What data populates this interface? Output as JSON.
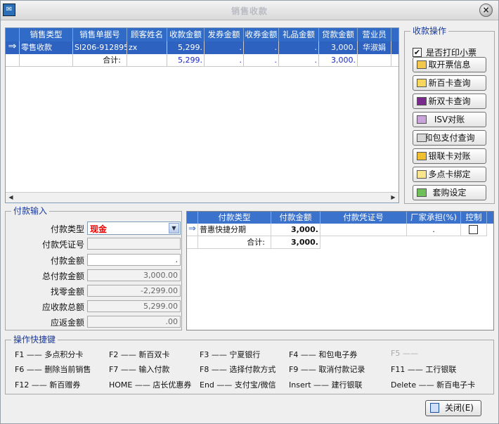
{
  "window": {
    "title": "销售收款"
  },
  "sales_grid": {
    "columns": [
      "销售类型",
      "销售单据号",
      "顾客姓名",
      "收款金额",
      "发券金额",
      "收券金额",
      "礼品金额",
      "贷款金额",
      "营业员"
    ],
    "rows": [
      {
        "type": "零售收款",
        "doc_no": "SI206-912895",
        "customer": "zx",
        "receive": "5,299.",
        "issue_coupon": ".",
        "recv_coupon": ".",
        "gift": ".",
        "loan": "3,000.",
        "clerk": "华淑娟"
      }
    ],
    "total": {
      "label": "合计:",
      "receive": "5,299.",
      "issue_coupon": ".",
      "recv_coupon": ".",
      "gift": ".",
      "loan": "3,000."
    }
  },
  "ops_panel": {
    "title": "收款操作",
    "print_checkbox": {
      "label": "是否打印小票",
      "checked_mark": "✔"
    },
    "buttons": [
      "取开票信息",
      "新百卡查询",
      "新双卡查询",
      "ISV对账",
      "和包支付查询",
      "银联卡对账",
      "多点卡绑定",
      "套购设定"
    ]
  },
  "payment_input": {
    "title": "付款输入",
    "pay_type_label": "付款类型",
    "pay_type_value": "现金",
    "voucher_label": "付款凭证号",
    "voucher_value": "",
    "amount_label": "付款金额",
    "amount_value": ".",
    "total_pay_label": "总付款金额",
    "total_pay_value": "3,000.00",
    "change_label": "找零金额",
    "change_value": "-2,299.00",
    "receivable_label": "应收款总额",
    "receivable_value": "5,299.00",
    "refund_label": "应返金额",
    "refund_value": ".00"
  },
  "payment_grid": {
    "columns": [
      "付款类型",
      "付款金额",
      "付款凭证号",
      "厂家承担(%)",
      "控制"
    ],
    "rows": [
      {
        "type": "普惠快捷分期",
        "amount": "3,000.",
        "voucher": "",
        "vendor": "."
      }
    ],
    "total": {
      "label": "合计:",
      "amount": "3,000."
    }
  },
  "shortcuts": {
    "title": "操作快捷键",
    "items": [
      {
        "key": "F1",
        "action": "多点积分卡"
      },
      {
        "key": "F2",
        "action": "新百双卡"
      },
      {
        "key": "F3",
        "action": "宁夏银行"
      },
      {
        "key": "F4",
        "action": "和包电子券"
      },
      {
        "key": "F5",
        "action": ""
      },
      {
        "key": "F6",
        "action": "删除当前销售"
      },
      {
        "key": "F7",
        "action": "输入付款"
      },
      {
        "key": "F8",
        "action": "选择付款方式"
      },
      {
        "key": "F9",
        "action": "取消付款记录"
      },
      {
        "key": "F11",
        "action": "工行银联"
      },
      {
        "key": "F12",
        "action": "新百赠券"
      },
      {
        "key": "HOME",
        "action": "店长优惠券"
      },
      {
        "key": "End",
        "action": "支付宝/微信"
      },
      {
        "key": "Insert",
        "action": "建行银联"
      },
      {
        "key": "Delete",
        "action": "新百电子卡"
      }
    ]
  },
  "footer": {
    "close_label": "关闭(E)"
  },
  "icons": [
    "app-icon",
    "close-icon",
    "row-arrow-icon",
    "dropdown-arrow-icon",
    "scroll-left-icon",
    "scroll-right-icon"
  ],
  "colors": {
    "header_blue": "#2f6bc7",
    "selection_blue": "#2e62c0",
    "pay_type_red": "#e00000",
    "amount_blue": "#1a27c8",
    "legend_blue": "#1a3a9a"
  }
}
